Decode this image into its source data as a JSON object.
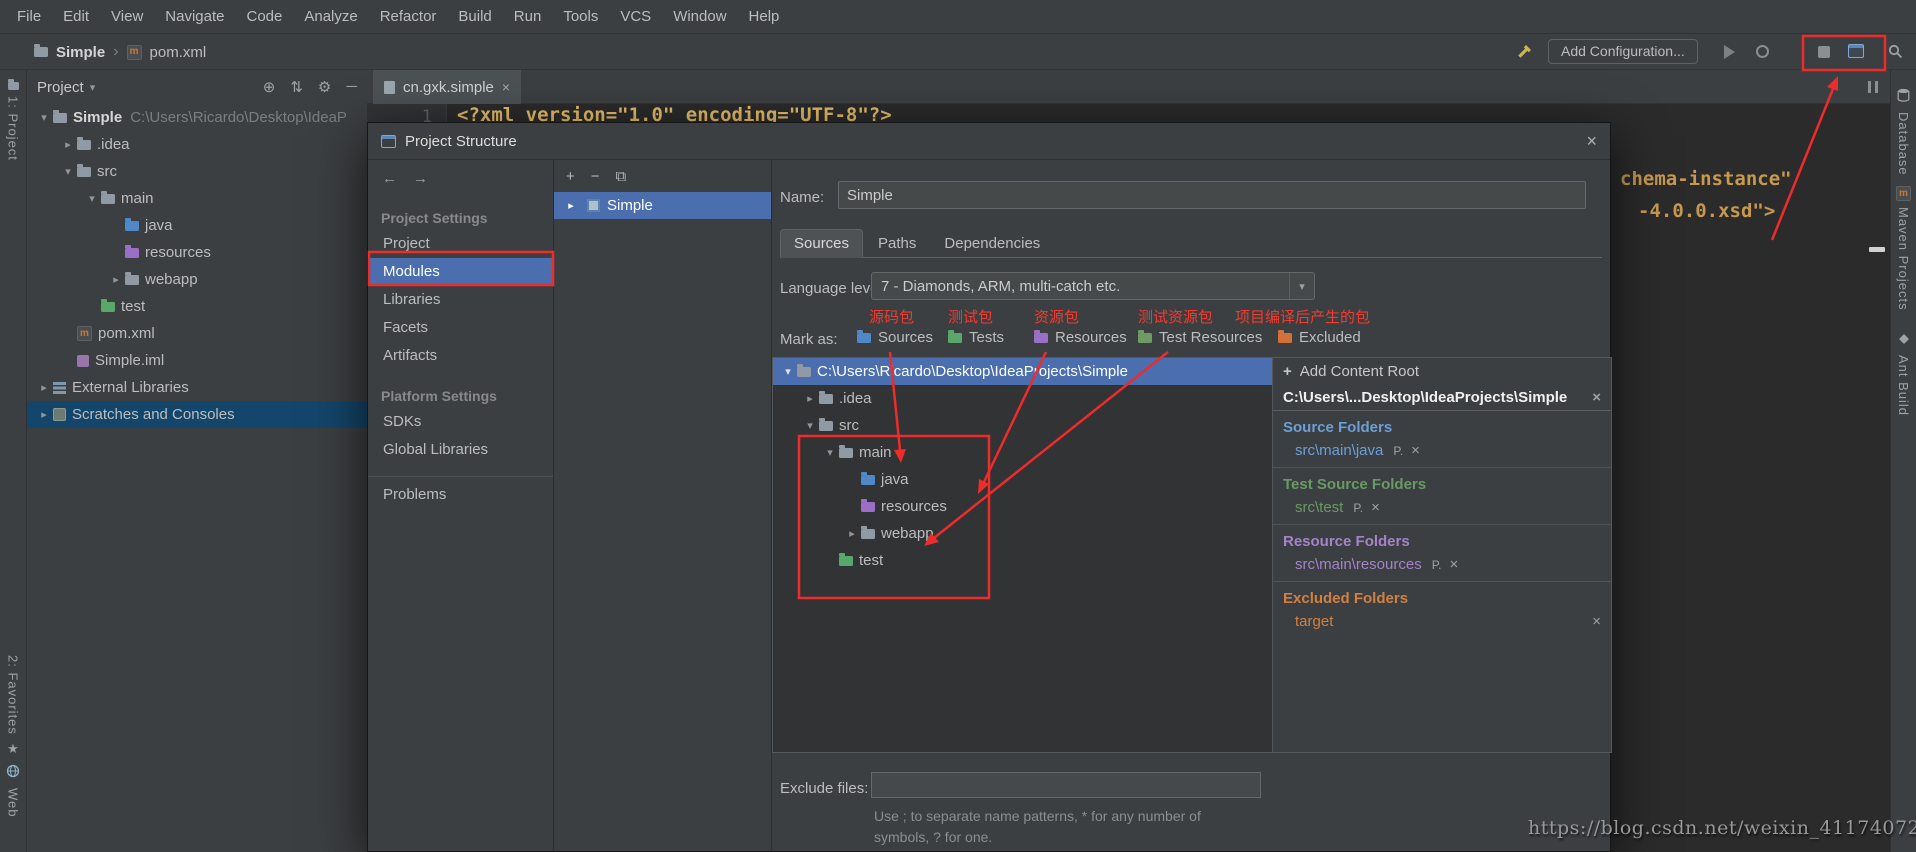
{
  "colors": {
    "annotation_red": "#ef2b2b",
    "selection_blue": "#4b6eaf",
    "unfocused_selection": "#14466b",
    "source_blue": "#4f87c7",
    "test_green": "#59a869",
    "resource_violet": "#9a70c7",
    "excluded_orange": "#d4713a",
    "panel_bg": "#3c3f41",
    "editor_bg": "#2b2b2b"
  },
  "icons": {
    "expanded": "▾",
    "collapsed": "▸",
    "close": "×",
    "breadcrumb_sep": "›",
    "dropdown": "▾",
    "back": "←",
    "forward": "→",
    "add": "+",
    "remove": "−",
    "copy": "⧉",
    "locate": "⊕",
    "sort": "⇅",
    "gear": "⚙",
    "hide": "─",
    "star": "★",
    "maven": "m"
  },
  "menu": {
    "items": [
      "File",
      "Edit",
      "View",
      "Navigate",
      "Code",
      "Analyze",
      "Refactor",
      "Build",
      "Run",
      "Tools",
      "VCS",
      "Window",
      "Help"
    ]
  },
  "navbar": {
    "project": "Simple",
    "file": "pom.xml",
    "add_configuration": "Add Configuration..."
  },
  "left_stripe": {
    "project": "1: Project",
    "favorites": "2: Favorites",
    "web": "Web"
  },
  "right_stripe": {
    "database": "Database",
    "maven": "Maven Projects",
    "ant": "Ant Build"
  },
  "project_panel": {
    "title": "Project",
    "root_name": "Simple",
    "root_path": "C:\\Users\\Ricardo\\Desktop\\IdeaP",
    "items": {
      "idea": ".idea",
      "src": "src",
      "main": "main",
      "java": "java",
      "resources": "resources",
      "webapp": "webapp",
      "test": "test",
      "pom": "pom.xml",
      "iml": "Simple.iml",
      "external": "External Libraries",
      "scratches": "Scratches and Consoles"
    }
  },
  "editor": {
    "tab": "cn.gxk.simple",
    "line_number": "1",
    "line1": "<?xml version=\"1.0\" encoding=\"UTF-8\"?>",
    "fragment1": "chema-instance\"",
    "fragment2": "-4.0.0.xsd\">"
  },
  "dialog": {
    "title": "Project Structure",
    "nav": {
      "project_settings": "Project Settings",
      "project": "Project",
      "modules": "Modules",
      "libraries": "Libraries",
      "facets": "Facets",
      "artifacts": "Artifacts",
      "platform_settings": "Platform Settings",
      "sdks": "SDKs",
      "global_libraries": "Global Libraries",
      "problems": "Problems"
    },
    "module_list": {
      "module": "Simple"
    },
    "name_label": "Name:",
    "name_value": "Simple",
    "tabs": {
      "sources": "Sources",
      "paths": "Paths",
      "dependencies": "Dependencies"
    },
    "language_level_label": "Language level:",
    "language_level_value": "7 - Diamonds, ARM, multi-catch etc.",
    "mark_as_label": "Mark as:",
    "mark_as": {
      "sources": "Sources",
      "tests": "Tests",
      "resources": "Resources",
      "test_resources": "Test Resources",
      "excluded": "Excluded"
    },
    "annotations": {
      "sources": "源码包",
      "tests": "测试包",
      "resources": "资源包",
      "test_resources": "测试资源包",
      "excluded": "项目编译后产生的包"
    },
    "tree": {
      "root": "C:\\Users\\Ricardo\\Desktop\\IdeaProjects\\Simple",
      "idea": ".idea",
      "src": "src",
      "main": "main",
      "java": "java",
      "resources": "resources",
      "webapp": "webapp",
      "test": "test"
    },
    "content": {
      "add_content_root": "Add Content Root",
      "root_path": "C:\\Users\\...Desktop\\IdeaProjects\\Simple",
      "source_folders": "Source Folders",
      "source_entry": "src\\main\\java",
      "test_folders": "Test Source Folders",
      "test_entry": "src\\test",
      "resource_folders": "Resource Folders",
      "resource_entry": "src\\main\\resources",
      "excluded_folders": "Excluded Folders",
      "excluded_entry": "target",
      "package_prefix_badge": "P."
    },
    "exclude_label": "Exclude files:",
    "exclude_value": "",
    "help_line1": "Use ; to separate name patterns, * for any number of",
    "help_line2": "symbols, ? for one."
  },
  "watermark": "https://blog.csdn.net/weixin_41174072"
}
